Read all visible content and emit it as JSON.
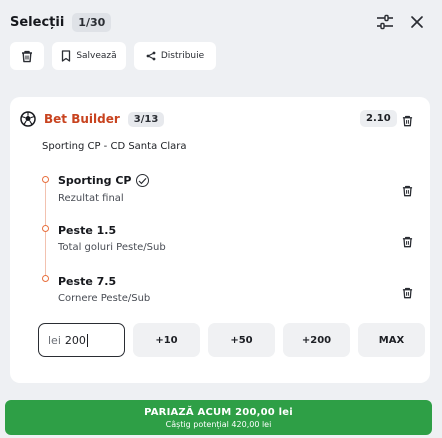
{
  "header": {
    "title": "Selecții",
    "counter": "1/30",
    "settings_icon": "sliders-icon",
    "close_icon": "close-icon"
  },
  "toolbar": {
    "delete_icon": "trash-icon",
    "save_label": "Salvează",
    "share_label": "Distribuie"
  },
  "bet_builder": {
    "title": "Bet Builder",
    "count": "3/13",
    "odds": "2.10",
    "match": "Sporting CP - CD Santa Clara",
    "selections": [
      {
        "name": "Sporting CP",
        "market": "Rezultat final",
        "has_check": true
      },
      {
        "name": "Peste 1.5",
        "market": "Total goluri Peste/Sub",
        "has_check": false
      },
      {
        "name": "Peste 7.5",
        "market": "Cornere Peste/Sub",
        "has_check": false
      }
    ],
    "check_symbol": "2"
  },
  "stake": {
    "currency": "lei",
    "value": "200",
    "quick_amounts": [
      "+10",
      "+50",
      "+200",
      "MAX"
    ]
  },
  "bet_button": {
    "label": "PARIAZĂ ACUM  200,00 lei",
    "potential_win": "Câștig potențial 420,00 lei"
  },
  "colors": {
    "accent": "#c8431f",
    "timeline": "#e8703f",
    "bet_green": "#2e9f46"
  }
}
